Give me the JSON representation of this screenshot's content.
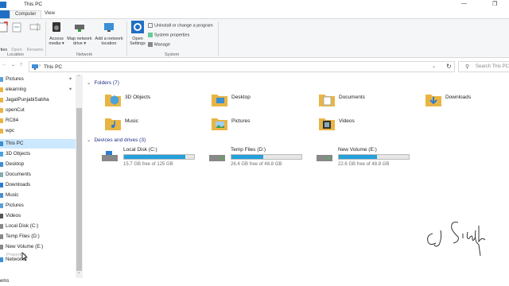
{
  "window": {
    "title": "This PC"
  },
  "ribbon": {
    "tabs": [
      {
        "label": "Computer"
      },
      {
        "label": "View"
      }
    ],
    "location": {
      "group_label": "Location",
      "properties_label": "rties",
      "open_label": "Open",
      "rename_label": "Rename"
    },
    "network": {
      "group_label": "Network",
      "access_media": [
        "Access",
        "media ▾"
      ],
      "map_drive": [
        "Map network",
        "drive ▾"
      ],
      "add_location": [
        "Add a network",
        "location"
      ]
    },
    "system": {
      "group_label": "System",
      "open_settings": [
        "Open",
        "Settings"
      ],
      "uninstall": "Uninstall or change a program",
      "system_properties": "System properties",
      "manage": "Manage"
    }
  },
  "address": {
    "path": "This PC",
    "search_placeholder": "Search This PC"
  },
  "nav": {
    "items": [
      {
        "label": "Pictures",
        "pinned": true
      },
      {
        "label": "elearning",
        "pinned": true
      },
      {
        "label": "JagatPunjabiSabha"
      },
      {
        "label": "openCut"
      },
      {
        "label": "RC84"
      },
      {
        "label": "wpc"
      },
      {
        "label": "This PC",
        "selected": true
      },
      {
        "label": "3D Objects"
      },
      {
        "label": "Desktop"
      },
      {
        "label": "Documents"
      },
      {
        "label": "Downloads"
      },
      {
        "label": "Music"
      },
      {
        "label": "Pictures"
      },
      {
        "label": "Videos"
      },
      {
        "label": "Local Disk (C:)"
      },
      {
        "label": "Temp Files (D:)"
      },
      {
        "label": "New Volume (E:)"
      },
      {
        "label": "Network"
      }
    ],
    "context_hint": "Properties"
  },
  "folders_section": {
    "title": "Folders (7)",
    "items": [
      {
        "label": "3D Objects",
        "icon": "3d-objects-icon"
      },
      {
        "label": "Desktop",
        "icon": "desktop-folder-icon"
      },
      {
        "label": "Documents",
        "icon": "documents-folder-icon"
      },
      {
        "label": "Downloads",
        "icon": "downloads-folder-icon"
      },
      {
        "label": "Music",
        "icon": "music-folder-icon"
      },
      {
        "label": "Pictures",
        "icon": "pictures-folder-icon"
      },
      {
        "label": "Videos",
        "icon": "videos-folder-icon"
      }
    ]
  },
  "drives_section": {
    "title": "Devices and drives (3)",
    "items": [
      {
        "label": "Local Disk (C:)",
        "free": "15.7 GB free of 125 GB",
        "used_fraction": 0.87
      },
      {
        "label": "Temp Files (D:)",
        "free": "26.4 GB free of 48.8 GB",
        "used_fraction": 0.46
      },
      {
        "label": "New Volume (E:)",
        "free": "22.6 GB free of 48.8 GB",
        "used_fraction": 0.54
      }
    ]
  },
  "status": {
    "items_label": "ems"
  },
  "colors": {
    "accent": "#26a0da",
    "selection": "#cce8ff",
    "folder": "#e8b545",
    "section_title": "#1e3287"
  }
}
